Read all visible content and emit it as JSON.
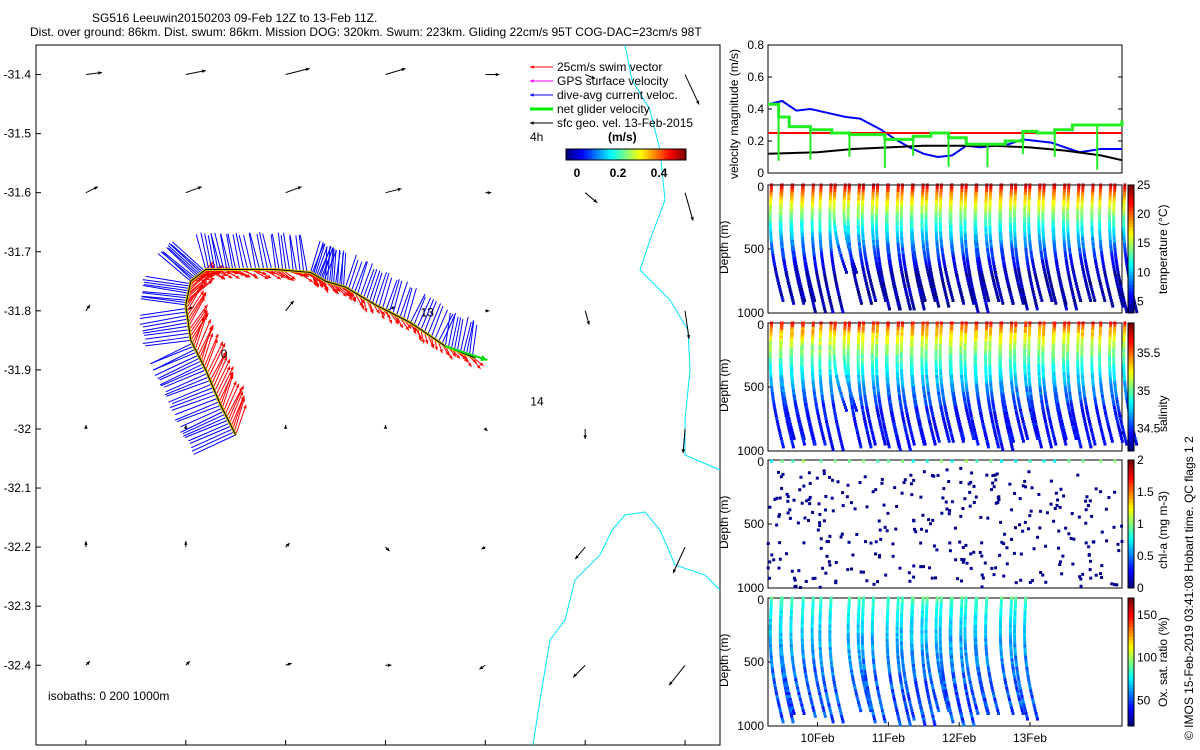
{
  "title": {
    "line1": "SG516 Leeuwin20150203 09-Feb 12Z to 13-Feb 11Z.",
    "line2": "Dist. over ground: 86km. Dist. swum: 86km. Mission DOG: 320km. Swum: 223km. Gliding 22cm/s 95T COG-DAC=23cm/s 98T"
  },
  "chart_data": [
    {
      "type": "map",
      "xlim": [
        113.5,
        114.87
      ],
      "ylim": [
        -32.535,
        -31.35
      ],
      "xticks": [
        "113.6",
        "113.8",
        "114",
        "114.2",
        "114.4",
        "114.6",
        "114.8"
      ],
      "xtick_vals": [
        113.6,
        113.8,
        114.0,
        114.2,
        114.4,
        114.6,
        114.8
      ],
      "yticks": [
        "-31.4",
        "-31.5",
        "-31.6",
        "-31.7",
        "-31.8",
        "-31.9",
        "-32",
        "-32.1",
        "-32.2",
        "-32.3",
        "-32.4"
      ],
      "ytick_vals": [
        -31.4,
        -31.5,
        -31.6,
        -31.7,
        -31.8,
        -31.9,
        -32.0,
        -32.1,
        -32.2,
        -32.3,
        -32.4
      ],
      "legend": [
        {
          "label": "25cm/s swim vector",
          "color": "#ff0000"
        },
        {
          "label": "GPS surface velocity",
          "color": "#ff00ff"
        },
        {
          "label": "dive-avg current veloc.",
          "color": "#0000ff"
        },
        {
          "label": "net glider velocity",
          "color": "#00ee00"
        },
        {
          "label": "sfc geo. vel. 13-Feb-2015",
          "color": "#000000"
        }
      ],
      "interval_label": "4h",
      "colorbar": {
        "label": "(m/s)",
        "ticks": [
          "0",
          "0.2",
          "0.4"
        ],
        "range": [
          0,
          0.5
        ]
      },
      "isobaths_label": "isobaths: 0   200  1000m",
      "track_labels": [
        {
          "text": "0",
          "lon": 113.87,
          "lat": -31.88
        },
        {
          "text": "13",
          "lon": 114.27,
          "lat": -31.81
        },
        {
          "text": "14",
          "lon": 114.49,
          "lat": -31.96
        }
      ],
      "track": [
        [
          113.9,
          -32.01
        ],
        [
          113.87,
          -31.96
        ],
        [
          113.84,
          -31.9
        ],
        [
          113.81,
          -31.85
        ],
        [
          113.8,
          -31.79
        ],
        [
          113.81,
          -31.75
        ],
        [
          113.84,
          -31.73
        ],
        [
          113.9,
          -31.73
        ],
        [
          113.98,
          -31.73
        ],
        [
          114.05,
          -31.735
        ],
        [
          114.08,
          -31.75
        ],
        [
          114.12,
          -31.76
        ],
        [
          114.18,
          -31.79
        ],
        [
          114.25,
          -31.82
        ],
        [
          114.32,
          -31.86
        ],
        [
          114.38,
          -31.88
        ]
      ],
      "sfc_vel": [
        [
          113.6,
          -31.4,
          0.08,
          0.01
        ],
        [
          113.8,
          -31.4,
          0.1,
          0.02
        ],
        [
          114.0,
          -31.4,
          0.12,
          0.03
        ],
        [
          114.2,
          -31.4,
          0.1,
          0.03
        ],
        [
          114.4,
          -31.4,
          0.07,
          0
        ],
        [
          114.6,
          -31.4,
          0.05,
          -0.02
        ],
        [
          114.8,
          -31.4,
          0.07,
          -0.15
        ],
        [
          113.6,
          -31.6,
          0.06,
          0.03
        ],
        [
          113.8,
          -31.6,
          0.08,
          0.03
        ],
        [
          114.0,
          -31.6,
          0.08,
          0.03
        ],
        [
          114.2,
          -31.6,
          0.08,
          0.02
        ],
        [
          114.4,
          -31.6,
          0.03,
          0
        ],
        [
          114.6,
          -31.6,
          0.06,
          -0.05
        ],
        [
          114.8,
          -31.6,
          0.04,
          -0.14
        ],
        [
          113.6,
          -31.8,
          0.02,
          0.03
        ],
        [
          113.8,
          -31.8,
          0.04,
          0.02
        ],
        [
          114.0,
          -31.8,
          0.04,
          0.05
        ],
        [
          114.2,
          -31.8,
          0.05,
          0.02
        ],
        [
          114.4,
          -31.8,
          0.02,
          0
        ],
        [
          114.6,
          -31.8,
          0.02,
          -0.07
        ],
        [
          114.8,
          -31.8,
          0.02,
          -0.14
        ],
        [
          113.6,
          -32.0,
          0,
          0.02
        ],
        [
          113.8,
          -32.0,
          0,
          0.02
        ],
        [
          114.0,
          -32.0,
          0.0,
          0.02
        ],
        [
          114.2,
          -32.0,
          0.0,
          0.02
        ],
        [
          114.4,
          -32.0,
          0.01,
          -0.01
        ],
        [
          114.6,
          -32.0,
          0,
          -0.05
        ],
        [
          114.8,
          -32.0,
          -0.01,
          -0.12
        ],
        [
          113.6,
          -32.2,
          0,
          0.03
        ],
        [
          113.8,
          -32.2,
          0,
          0.03
        ],
        [
          114.0,
          -32.2,
          0.02,
          0.02
        ],
        [
          114.2,
          -32.2,
          0.02,
          -0.02
        ],
        [
          114.4,
          -32.2,
          -0.02,
          -0.01
        ],
        [
          114.6,
          -32.2,
          -0.05,
          -0.06
        ],
        [
          114.8,
          -32.2,
          -0.06,
          -0.13
        ],
        [
          113.6,
          -32.4,
          0.02,
          0.02
        ],
        [
          113.8,
          -32.4,
          0.02,
          0.02
        ],
        [
          114.0,
          -32.4,
          0.03,
          0.01
        ],
        [
          114.2,
          -32.4,
          0.03,
          0
        ],
        [
          114.4,
          -32.4,
          -0.03,
          -0.02
        ],
        [
          114.6,
          -32.4,
          -0.06,
          -0.06
        ],
        [
          114.8,
          -32.4,
          -0.08,
          -0.1
        ]
      ]
    },
    {
      "type": "line",
      "ylabel": "velocity magnitude (m/s)",
      "ylim": [
        0,
        0.8
      ],
      "yticks": [
        "0",
        "0.2",
        "0.4",
        "0.6",
        "0.8"
      ],
      "xlim": [
        9.3,
        14.3
      ],
      "series": [
        {
          "name": "dive-avg current",
          "color": "#0000ff",
          "x": [
            9.3,
            9.5,
            9.7,
            9.9,
            10.2,
            10.4,
            10.6,
            10.9,
            11.1,
            11.3,
            11.5,
            11.7,
            11.9,
            12.1,
            12.3,
            12.5,
            12.7,
            12.9,
            13.1,
            13.3,
            13.5,
            13.7,
            14.0,
            14.3
          ],
          "y": [
            0.43,
            0.45,
            0.39,
            0.4,
            0.37,
            0.35,
            0.34,
            0.27,
            0.21,
            0.16,
            0.12,
            0.1,
            0.11,
            0.17,
            0.16,
            0.17,
            0.18,
            0.21,
            0.2,
            0.19,
            0.16,
            0.13,
            0.15,
            0.15
          ]
        },
        {
          "name": "swim 25cm/s",
          "color": "#ff0000",
          "x": [
            9.3,
            14.3
          ],
          "y": [
            0.25,
            0.25
          ]
        },
        {
          "name": "sfc geo vel",
          "color": "#000000",
          "x": [
            9.3,
            10.0,
            10.5,
            11.0,
            11.5,
            12.0,
            12.5,
            13.0,
            13.5,
            14.0,
            14.3
          ],
          "y": [
            0.12,
            0.13,
            0.15,
            0.16,
            0.17,
            0.17,
            0.17,
            0.16,
            0.14,
            0.11,
            0.08
          ]
        },
        {
          "name": "net glider velocity",
          "color": "#22ee22",
          "x": [
            9.3,
            9.45,
            9.6,
            9.9,
            10.2,
            10.45,
            10.75,
            10.95,
            11.15,
            11.35,
            11.6,
            11.85,
            12.1,
            12.4,
            12.65,
            12.9,
            13.1,
            13.35,
            13.6,
            13.95,
            14.3
          ],
          "y": [
            0.43,
            0.35,
            0.29,
            0.27,
            0.25,
            0.24,
            0.24,
            0.21,
            0.21,
            0.23,
            0.25,
            0.22,
            0.18,
            0.18,
            0.2,
            0.26,
            0.25,
            0.27,
            0.3,
            0.3,
            0.33
          ]
        }
      ]
    },
    {
      "type": "scatter",
      "ylabel": "Depth (m)",
      "cbar_label": "temperature (°C)",
      "cbar_ticks": [
        "5",
        "10",
        "15",
        "20",
        "25"
      ],
      "cbar_vals": [
        5,
        10,
        15,
        20,
        25
      ],
      "clim": [
        3,
        25
      ],
      "ylim": [
        0,
        1000
      ],
      "yticks": [
        "0",
        "500",
        "1000"
      ],
      "xlim": [
        9.3,
        14.3
      ],
      "max_depth": 1000,
      "surface": [
        24,
        25
      ],
      "deep": [
        3,
        5
      ]
    },
    {
      "type": "scatter",
      "ylabel": "Depth (m)",
      "cbar_label": "salinity",
      "cbar_ticks": [
        "34.5",
        "35",
        "35.5"
      ],
      "cbar_vals": [
        34.5,
        35,
        35.5
      ],
      "clim": [
        34.2,
        35.9
      ],
      "ylim": [
        0,
        1000
      ],
      "yticks": [
        "0",
        "500",
        "1000"
      ],
      "xlim": [
        9.3,
        14.3
      ],
      "max_depth": 1000,
      "surface": [
        35.6,
        35.8
      ],
      "deep": [
        34.35,
        34.5
      ]
    },
    {
      "type": "scatter",
      "ylabel": "Depth (m)",
      "cbar_label": "chl-a (mg m-3)",
      "cbar_ticks": [
        "0",
        "0.5",
        "1",
        "1.5",
        "2"
      ],
      "cbar_vals": [
        0,
        0.5,
        1,
        1.5,
        2
      ],
      "clim": [
        0,
        2
      ],
      "ylim": [
        0,
        1000
      ],
      "yticks": [
        "0",
        "500",
        "1000"
      ],
      "xlim": [
        9.3,
        14.3
      ],
      "sparse": true
    },
    {
      "type": "scatter",
      "ylabel": "Depth (m)",
      "cbar_label": "Ox. sat. ratio (%)",
      "cbar_ticks": [
        "50",
        "100",
        "150"
      ],
      "cbar_vals": [
        50,
        100,
        150
      ],
      "clim": [
        20,
        170
      ],
      "ylim": [
        0,
        1000
      ],
      "yticks": [
        "0",
        "500",
        "1000"
      ],
      "xlim": [
        9.3,
        14.3
      ],
      "max_depth": 1000,
      "surface": [
        85,
        95
      ],
      "deep": [
        40,
        60
      ],
      "subset": [
        0,
        1,
        3,
        4,
        6,
        7,
        9,
        10,
        11,
        12,
        13,
        14,
        15,
        16,
        18,
        19
      ]
    }
  ],
  "time_axis": {
    "ticks": [
      "10Feb",
      "11Feb",
      "12Feb",
      "13Feb"
    ],
    "tick_vals": [
      10,
      11,
      12,
      13
    ]
  },
  "dive_times": [
    9.35,
    9.5,
    9.65,
    9.8,
    10.05,
    10.25,
    10.45,
    10.65,
    10.85,
    11.0,
    11.2,
    11.35,
    11.55,
    11.75,
    11.9,
    12.1,
    12.25,
    12.45,
    12.6,
    12.8,
    13.0,
    13.2,
    13.35,
    13.55,
    13.75,
    14.0,
    14.2
  ],
  "footer": "© IMOS 15-Feb-2019 03:41:08 Hobart time. QC flags 1  2"
}
